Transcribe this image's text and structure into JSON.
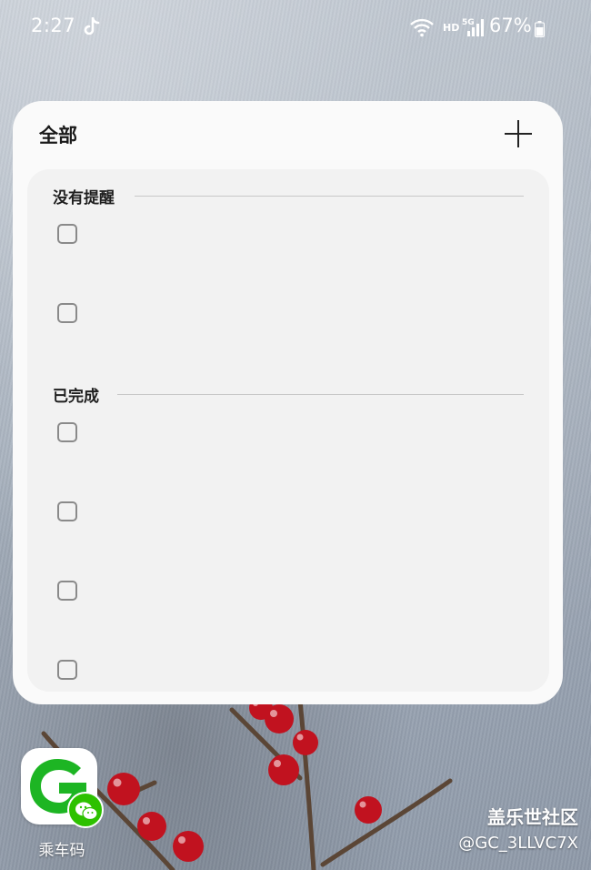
{
  "status_bar": {
    "time": "2:27",
    "network_label": "HD",
    "network_type": "5G",
    "battery": "67%"
  },
  "widget": {
    "title": "全部",
    "add_icon": "plus-icon",
    "sections": [
      {
        "label": "没有提醒",
        "item_count": 2
      },
      {
        "label": "已完成",
        "item_count": 4
      }
    ]
  },
  "home": {
    "app_label": "乘车码",
    "badge_icon": "wechat-icon"
  },
  "watermark": {
    "title": "盖乐世社区",
    "user": "@GC_3LLVC7X"
  },
  "colors": {
    "widget_bg": "#fafafa",
    "widget_inner_bg": "#f2f2f2",
    "app_green": "#2dc100",
    "berry_red": "#c1121f"
  }
}
